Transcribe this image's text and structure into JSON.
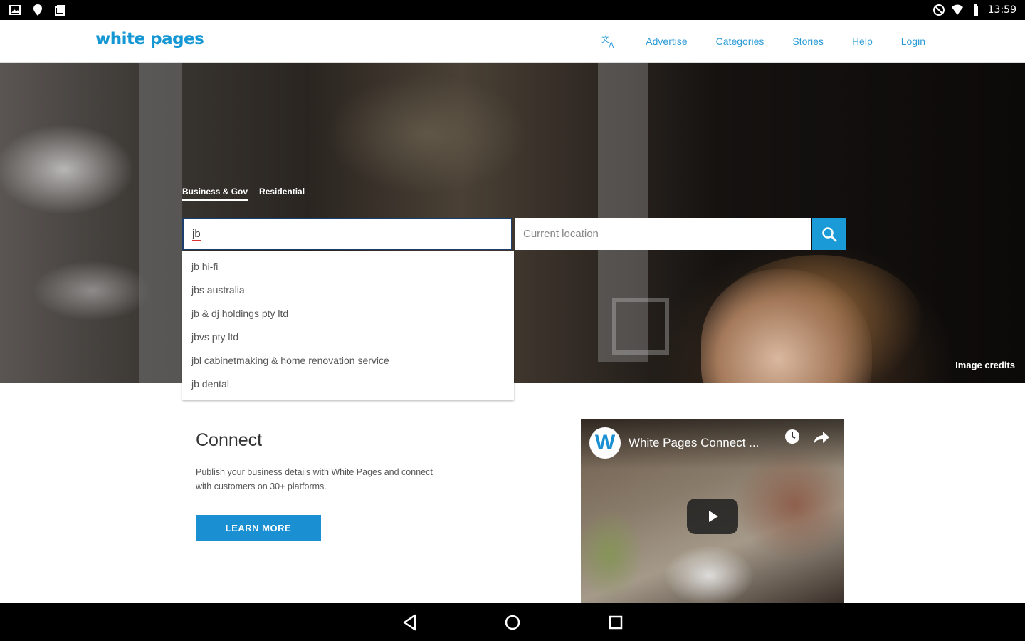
{
  "status_bar": {
    "time": "13:59",
    "left_icons": [
      "gallery-icon",
      "location-icon",
      "photos-icon"
    ],
    "right_icons": [
      "no-disturb-icon",
      "wifi-icon",
      "battery-icon"
    ]
  },
  "header": {
    "logo_text": "white pages",
    "nav": {
      "language_icon": "translate-icon",
      "advertise": "Advertise",
      "categories": "Categories",
      "stories": "Stories",
      "help": "Help",
      "login": "Login"
    }
  },
  "hero": {
    "tabs": [
      {
        "label": "Business & Gov",
        "active": true
      },
      {
        "label": "Residential",
        "active": false
      }
    ],
    "search": {
      "what_value": "jb",
      "where_placeholder": "Current location",
      "button_icon": "search-icon"
    },
    "suggestions": [
      "jb hi-fi",
      "jbs australia",
      "jb & dj holdings pty ltd",
      "jbvs pty ltd",
      "jbl cabinetmaking & home renovation service",
      "jb dental"
    ],
    "image_credits": "Image credits"
  },
  "connect": {
    "title": "Connect",
    "text": "Publish your business details with White Pages and connect with customers on 30+ platforms.",
    "button": "LEARN MORE"
  },
  "video": {
    "title": "White Pages Connect ...",
    "logo_letter": "W"
  },
  "colors": {
    "brand_blue": "#1a9ad6",
    "nav_link": "#2b9bd6"
  }
}
